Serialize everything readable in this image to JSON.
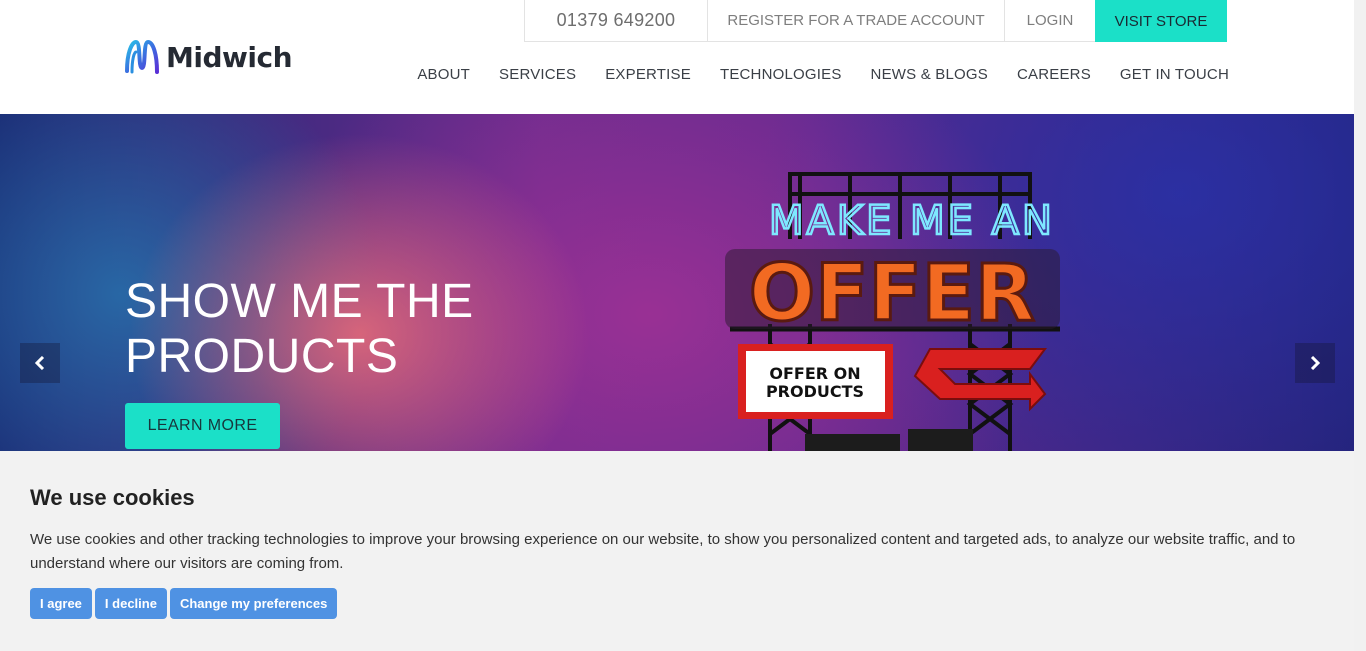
{
  "header": {
    "logo_text": "Midwich",
    "topbar": {
      "phone": "01379 649200",
      "register": "REGISTER FOR A TRADE ACCOUNT",
      "login": "LOGIN",
      "store": "VISIT STORE"
    },
    "nav": [
      "ABOUT",
      "SERVICES",
      "EXPERTISE",
      "TECHNOLOGIES",
      "NEWS & BLOGS",
      "CAREERS",
      "GET IN TOUCH"
    ]
  },
  "hero": {
    "title_line1": "SHOW ME THE",
    "title_line2": "PRODUCTS",
    "cta": "LEARN MORE",
    "billboard": {
      "neon_text": "MAKE ME AN",
      "offer_text": "OFFER",
      "sign_line1": "OFFER ON",
      "sign_line2": "PRODUCTS"
    }
  },
  "cookie": {
    "title": "We use cookies",
    "text": "We use cookies and other tracking technologies to improve your browsing experience on our website, to show you personalized content and targeted ads, to analyze our website traffic, and to understand where our visitors are coming from.",
    "buttons": {
      "agree": "I agree",
      "decline": "I decline",
      "preferences": "Change my preferences"
    }
  },
  "colors": {
    "accent": "#1be0c8",
    "cookie_button": "#4f92e3",
    "offer_orange": "#f26a22"
  }
}
